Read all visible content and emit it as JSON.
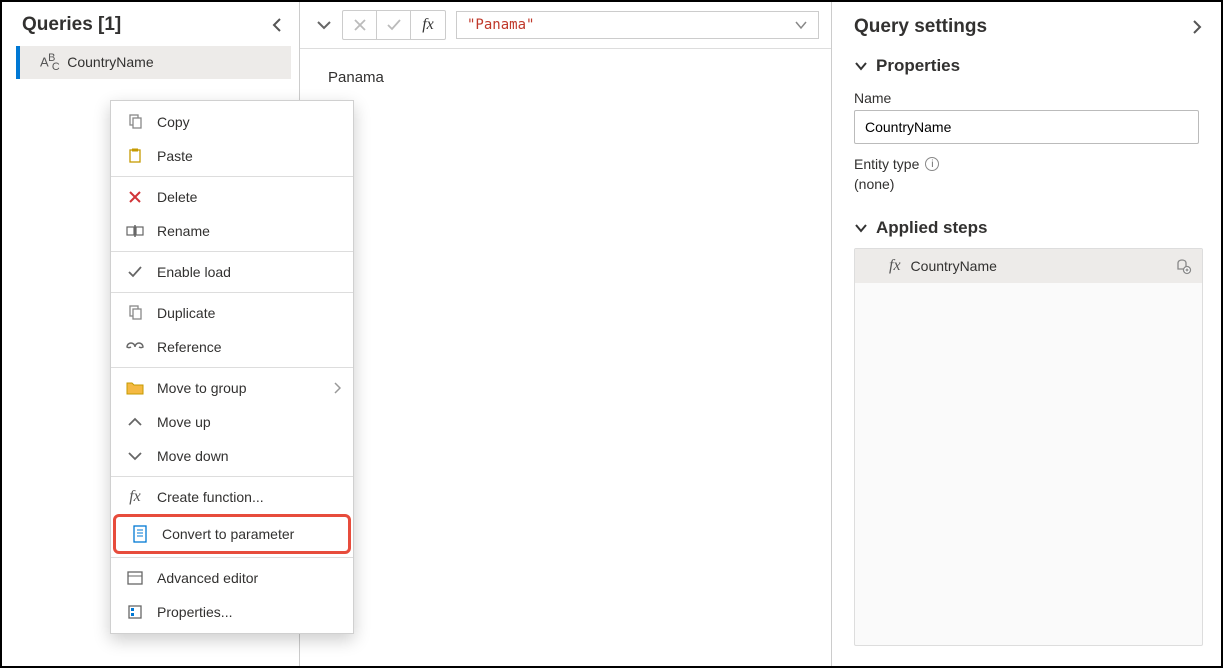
{
  "left": {
    "title": "Queries [1]",
    "selected_query": "CountryName"
  },
  "context_menu": {
    "copy": "Copy",
    "paste": "Paste",
    "delete": "Delete",
    "rename": "Rename",
    "enable_load": "Enable load",
    "duplicate": "Duplicate",
    "reference": "Reference",
    "move_to_group": "Move to group",
    "move_up": "Move up",
    "move_down": "Move down",
    "create_function": "Create function...",
    "convert_to_parameter": "Convert to parameter",
    "advanced_editor": "Advanced editor",
    "properties": "Properties..."
  },
  "formula_bar": {
    "value": "\"Panama\""
  },
  "preview": {
    "value": "Panama"
  },
  "settings": {
    "title": "Query settings",
    "properties_label": "Properties",
    "name_label": "Name",
    "name_value": "CountryName",
    "entity_type_label": "Entity type",
    "entity_type_value": "(none)",
    "applied_steps_label": "Applied steps",
    "step_name": "CountryName"
  }
}
